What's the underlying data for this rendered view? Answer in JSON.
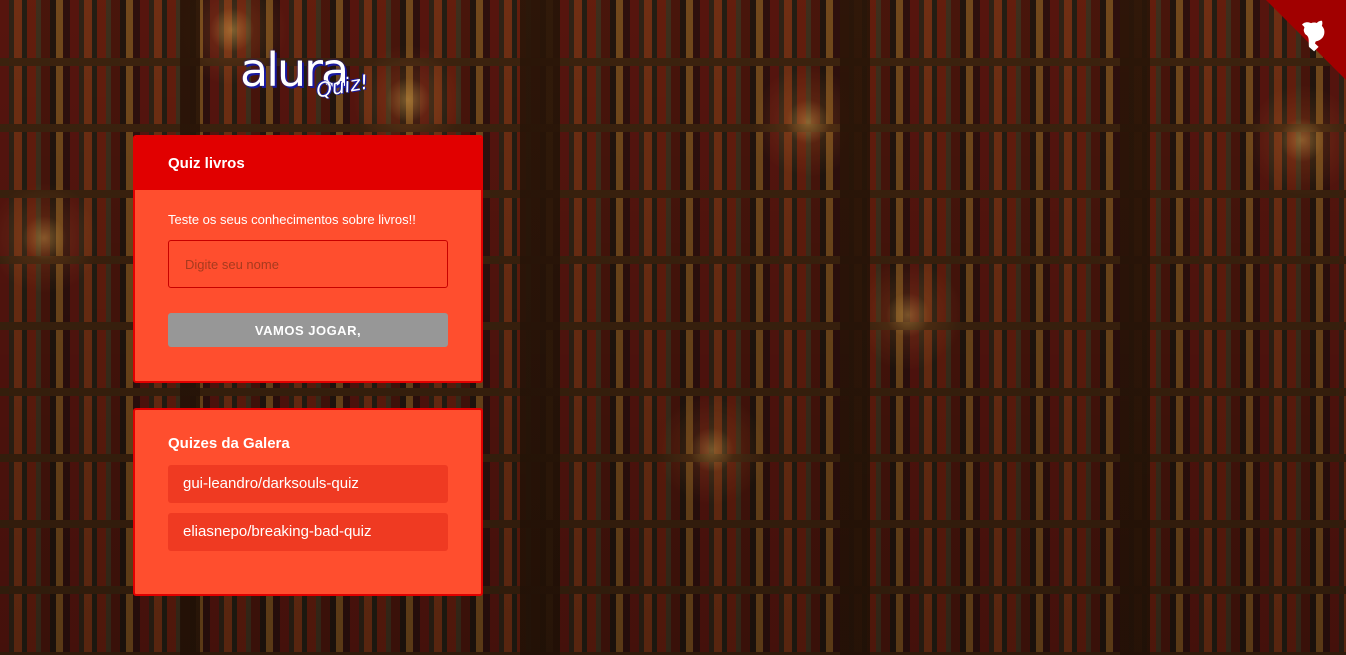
{
  "brand": {
    "logo_main": "alura",
    "logo_sub": "Quiz!"
  },
  "main_card": {
    "title": "Quiz livros",
    "description": "Teste os seus conhecimentos sobre livros!!",
    "name_input": {
      "placeholder": "Digite seu nome",
      "value": ""
    },
    "play_label": "VAMOS JOGAR,"
  },
  "others_card": {
    "title": "Quizes da Galera",
    "quizzes": [
      {
        "label": "gui-leandro/darksouls-quiz"
      },
      {
        "label": "eliasnepo/breaking-bad-quiz"
      }
    ]
  },
  "colors": {
    "primary": "#e10000",
    "main_bg": "#ff4e2e",
    "secondary": "#ef3a22",
    "button_disabled": "#979797",
    "contrast_text": "#ffffff"
  },
  "icons": {
    "corner": "github-octocat-icon"
  }
}
